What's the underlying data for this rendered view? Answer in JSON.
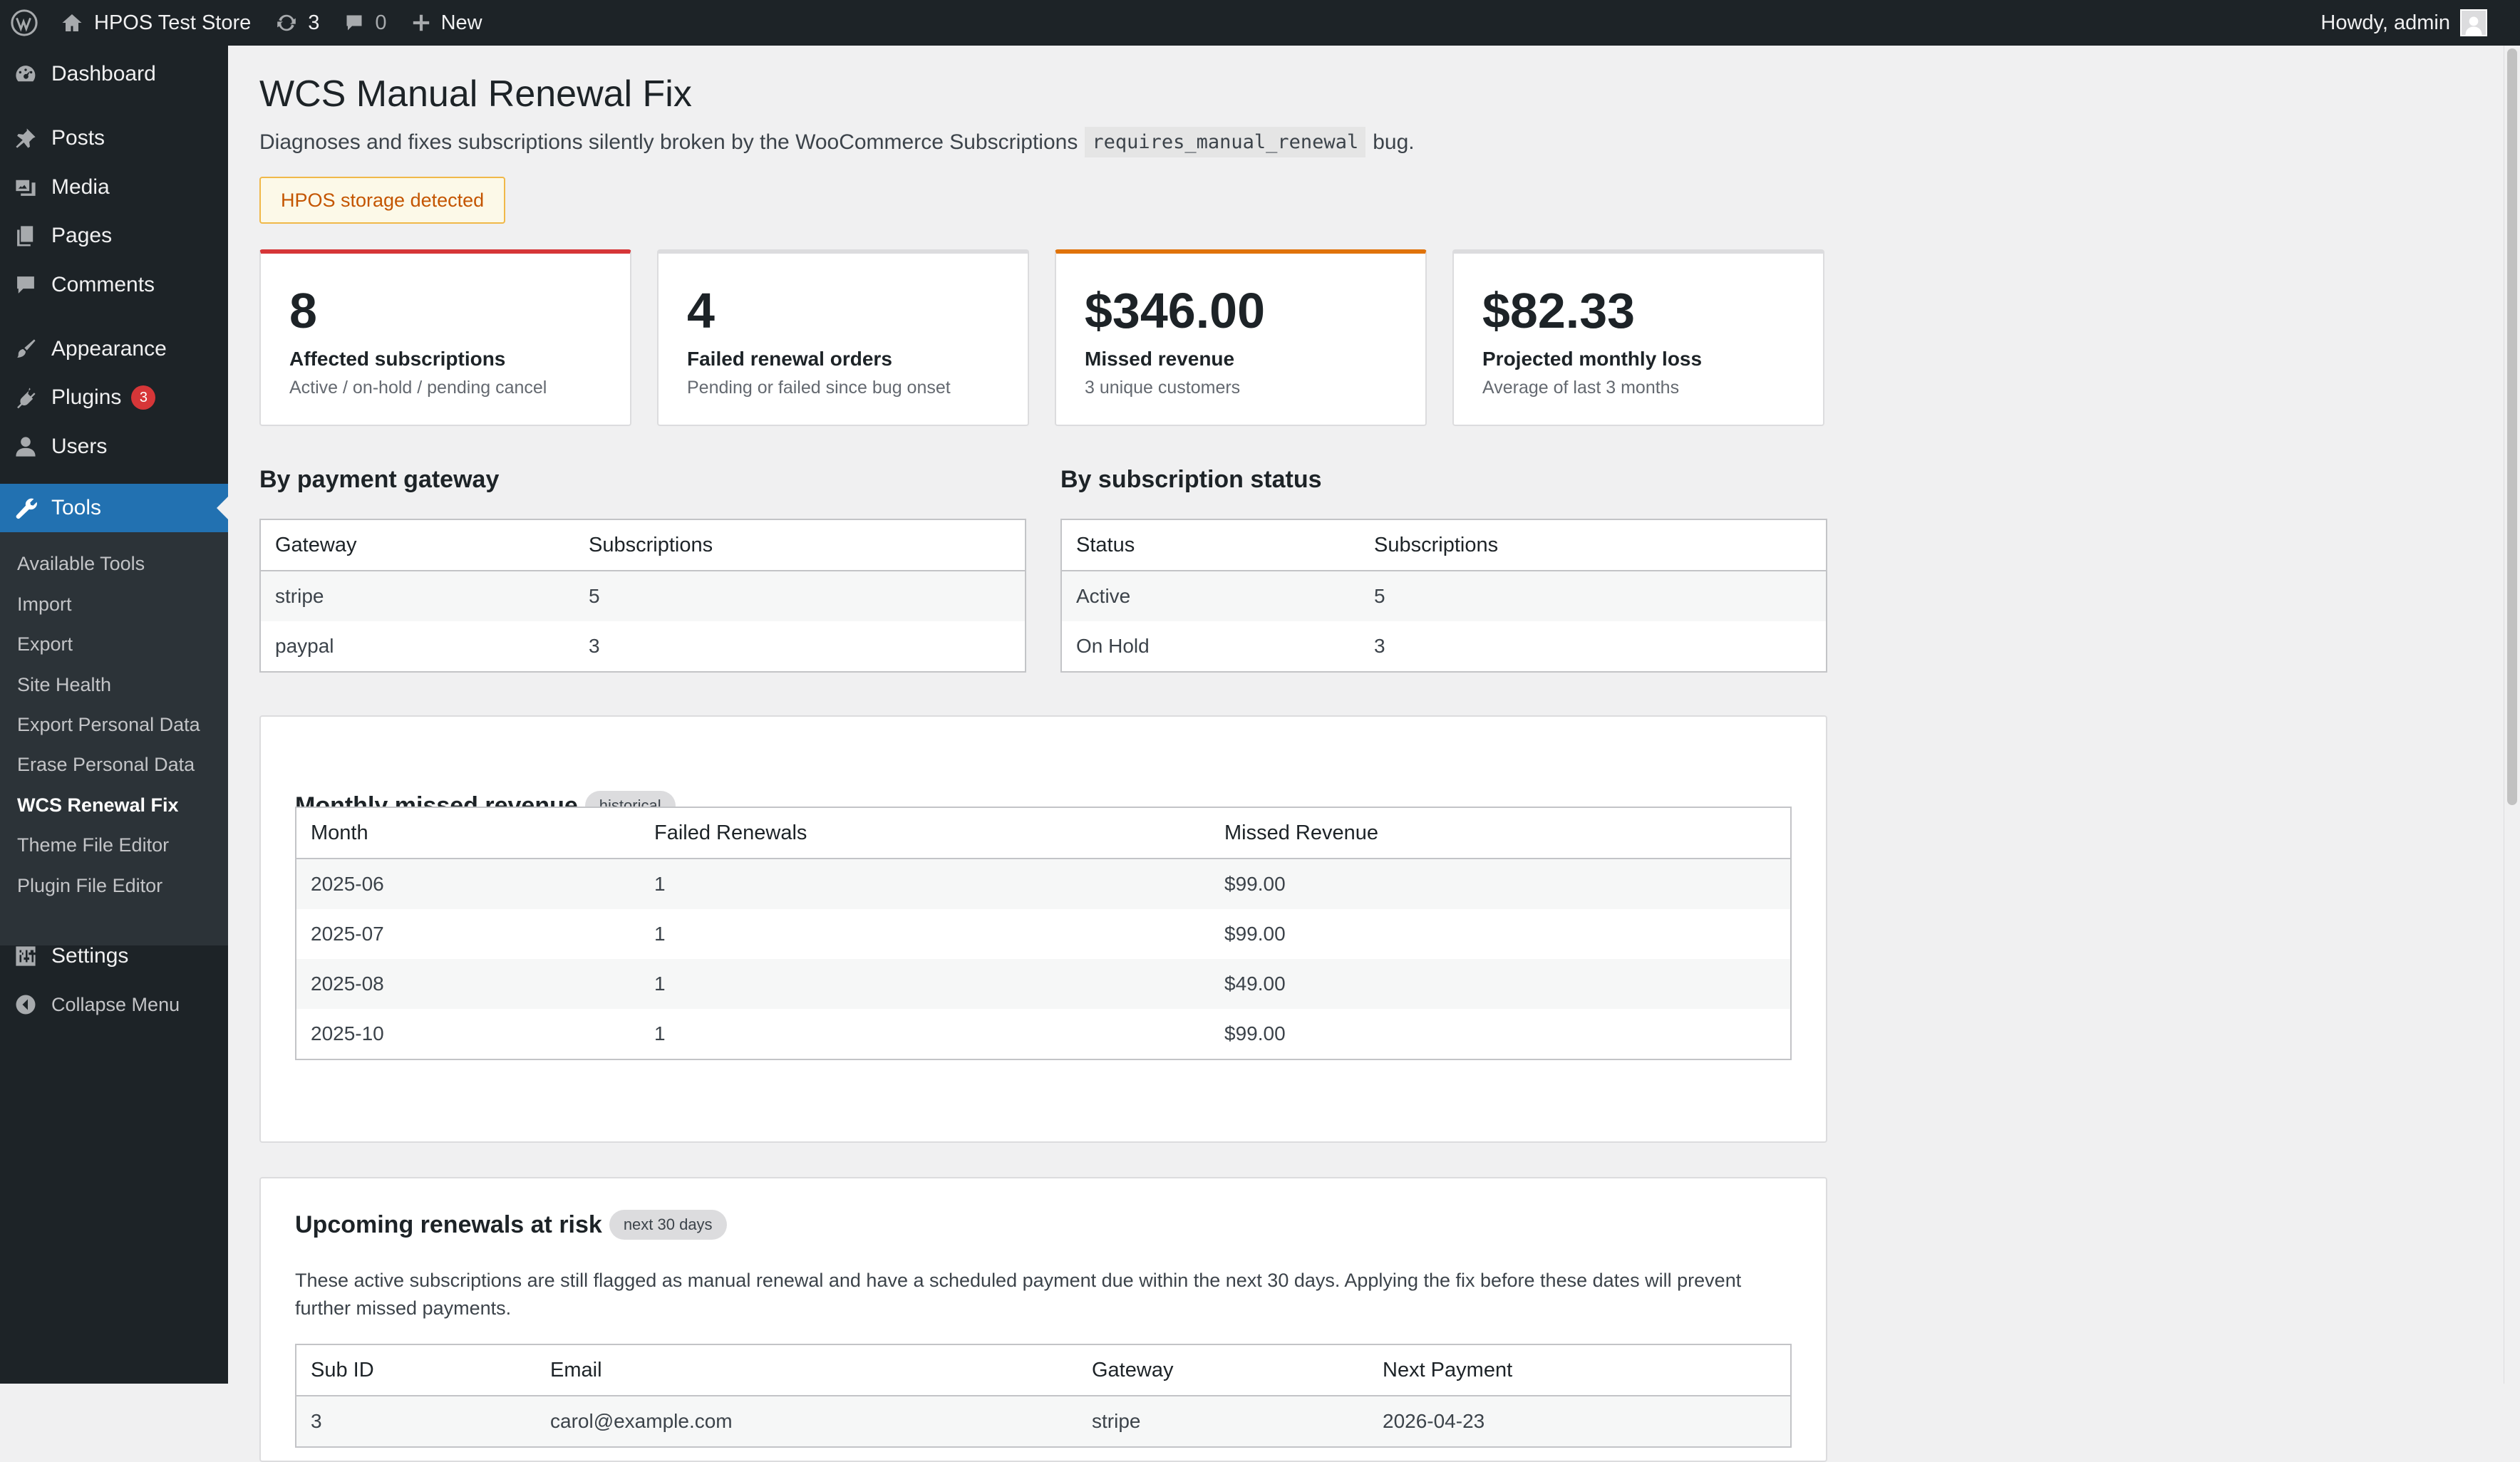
{
  "adminbar": {
    "site_name": "HPOS Test Store",
    "updates_count": "3",
    "comments_count": "0",
    "new_label": "New",
    "greeting": "Howdy, admin"
  },
  "sidebar": {
    "dashboard": "Dashboard",
    "posts": "Posts",
    "media": "Media",
    "pages": "Pages",
    "comments": "Comments",
    "appearance": "Appearance",
    "plugins": "Plugins",
    "plugins_badge": "3",
    "users": "Users",
    "tools": "Tools",
    "submenu": [
      "Available Tools",
      "Import",
      "Export",
      "Site Health",
      "Export Personal Data",
      "Erase Personal Data",
      "WCS Renewal Fix",
      "Theme File Editor",
      "Plugin File Editor"
    ],
    "settings": "Settings",
    "collapse": "Collapse Menu"
  },
  "page": {
    "title": "WCS Manual Renewal Fix",
    "desc_before": "Diagnoses and fixes subscriptions silently broken by the WooCommerce Subscriptions",
    "desc_code": "requires_manual_renewal",
    "desc_after": "bug.",
    "notice": "HPOS storage detected"
  },
  "stats": [
    {
      "value": "8",
      "label": "Affected subscriptions",
      "sub": "Active / on-hold / pending cancel"
    },
    {
      "value": "4",
      "label": "Failed renewal orders",
      "sub": "Pending or failed since bug onset"
    },
    {
      "value": "$346.00",
      "label": "Missed revenue",
      "sub": "3 unique customers"
    },
    {
      "value": "$82.33",
      "label": "Projected monthly loss",
      "sub": "Average of last 3 months"
    }
  ],
  "by_gateway": {
    "heading": "By payment gateway",
    "headers": [
      "Gateway",
      "Subscriptions"
    ],
    "rows": [
      [
        "stripe",
        "5"
      ],
      [
        "paypal",
        "3"
      ]
    ]
  },
  "by_status": {
    "heading": "By subscription status",
    "headers": [
      "Status",
      "Subscriptions"
    ],
    "rows": [
      [
        "Active",
        "5"
      ],
      [
        "On Hold",
        "3"
      ]
    ]
  },
  "monthly": {
    "title": "Monthly missed revenue",
    "pill": "historical",
    "headers": [
      "Month",
      "Failed Renewals",
      "Missed Revenue"
    ],
    "rows": [
      [
        "2025-06",
        "1",
        "$99.00"
      ],
      [
        "2025-07",
        "1",
        "$99.00"
      ],
      [
        "2025-08",
        "1",
        "$49.00"
      ],
      [
        "2025-10",
        "1",
        "$99.00"
      ]
    ]
  },
  "upcoming": {
    "title": "Upcoming renewals at risk",
    "pill": "next 30 days",
    "desc": "These active subscriptions are still flagged as manual renewal and have a scheduled payment due within the next 30 days. Applying the fix before these dates will prevent further missed payments.",
    "headers": [
      "Sub ID",
      "Email",
      "Gateway",
      "Next Payment"
    ],
    "rows": [
      [
        "3",
        "carol@example.com",
        "stripe",
        "2026-04-23"
      ]
    ]
  }
}
